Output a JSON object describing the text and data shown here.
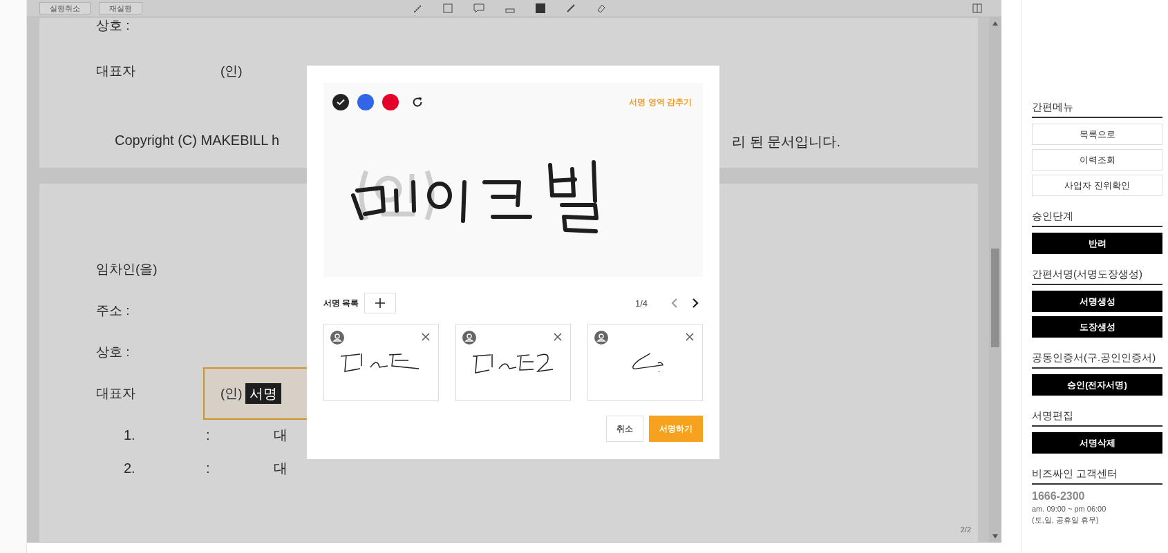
{
  "toolbar": {
    "buttons": [
      "실행취소",
      "재실행"
    ]
  },
  "page_1": {
    "company_label": "상호 :",
    "rep_label": "대표자",
    "seal": "(인)",
    "copyright_left": "Copyright (C) MAKEBILL h",
    "copyright_right": "리 된 문서입니다."
  },
  "page_2": {
    "labels": [
      "임차인(을)",
      "주소 :",
      "상호 :"
    ],
    "rep_label": "대표자",
    "seal": "(인)",
    "sign_tag": "서명",
    "items": [
      {
        "number": "1.",
        "colon": ":",
        "value": "대"
      },
      {
        "number": "2.",
        "colon": ":",
        "value": "대"
      }
    ],
    "page_number": "2/2"
  },
  "signature_dialog": {
    "colors": [
      {
        "color": "#222222",
        "selected": true
      },
      {
        "color": "#3366e6",
        "selected": false
      },
      {
        "color": "#e5002b",
        "selected": false
      }
    ],
    "hide_link": "서명 영역 감추기",
    "list_label": "서명 목록",
    "pager": "1/4",
    "cancel": "취소",
    "confirm": "서명하기"
  },
  "sidebar": [
    {
      "title": "간편메뉴",
      "kind": "outline",
      "buttons": [
        "목록으로",
        "이력조회",
        "사업자 진위확인"
      ]
    },
    {
      "title": "승인단계",
      "kind": "solid",
      "buttons": [
        "반려"
      ]
    },
    {
      "title": "간편서명(서명도장생성)",
      "kind": "solid",
      "buttons": [
        "서명생성",
        "도장생성"
      ]
    },
    {
      "title": "공동인증서(구.공인인증서)",
      "kind": "solid",
      "buttons": [
        "승인(전자서명)"
      ]
    },
    {
      "title": "서명편집",
      "kind": "solid",
      "buttons": [
        "서명삭제"
      ]
    },
    {
      "title": "비즈싸인 고객센터",
      "kind": "contact",
      "phone": "1666-2300",
      "hours": "am. 09:00 ~ pm 06:00",
      "note": "(토,일, 공휴일 휴무)"
    }
  ]
}
